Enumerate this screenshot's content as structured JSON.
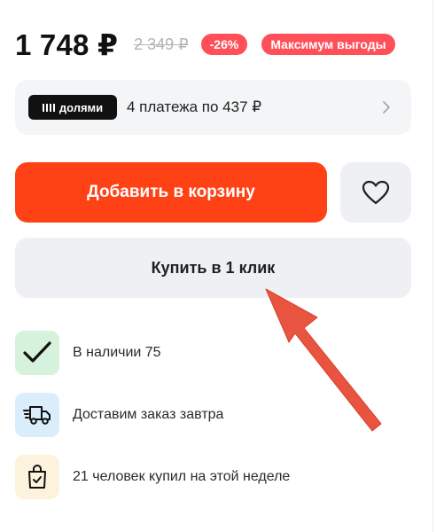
{
  "price": {
    "current": "1 748 ₽",
    "old": "2 349 ₽",
    "discount_badge": "-26%",
    "benefit_badge": "Максимум выгоды",
    "badge_color": "#ff4f58"
  },
  "installments": {
    "logo_text": "долями",
    "text": "4 платежа по 437 ₽",
    "icon": "chevron-right-icon"
  },
  "actions": {
    "add_to_cart_label": "Добавить в корзину",
    "add_to_cart_color": "#ff4216",
    "favorite_icon": "heart-icon",
    "buy_one_click_label": "Купить в 1 клик"
  },
  "info": [
    {
      "icon": "checkmark-icon",
      "text": "В наличии 75"
    },
    {
      "icon": "delivery-truck-icon",
      "text": "Доставим заказ завтра"
    },
    {
      "icon": "shopping-bag-check-icon",
      "text": "21 человек купил на этой неделе"
    }
  ],
  "annotation": {
    "icon": "red-arrow-icon",
    "color": "#e8543f"
  }
}
